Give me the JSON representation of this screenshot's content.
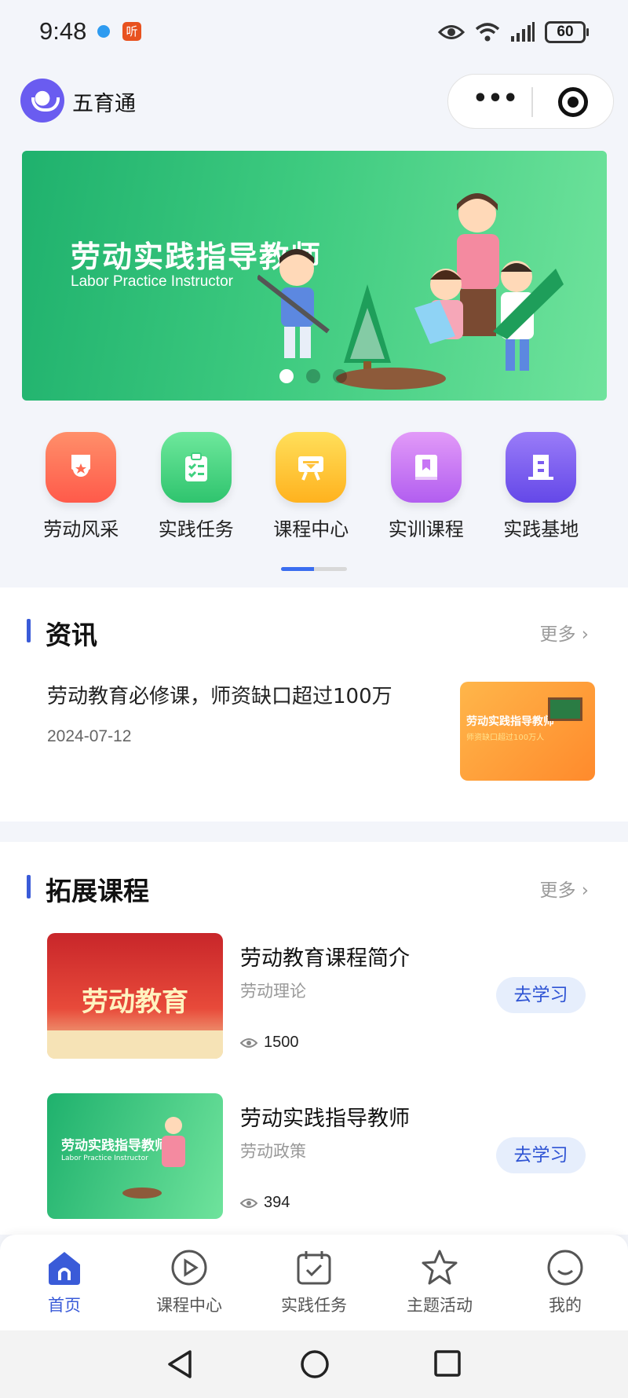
{
  "status_bar": {
    "time": "9:48",
    "notif_badge": "听",
    "battery": "60"
  },
  "app": {
    "name": "五育通"
  },
  "banner": {
    "title": "劳动实践指导教师",
    "subtitle": "Labor Practice Instructor",
    "active_index": 0,
    "dot_count": 3
  },
  "quick_nav": [
    {
      "label": "劳动风采",
      "icon": "medal-icon",
      "color": "#ff6b52"
    },
    {
      "label": "实践任务",
      "icon": "clipboard-check-icon",
      "color": "#3fd07f"
    },
    {
      "label": "课程中心",
      "icon": "course-board-icon",
      "color": "#ffc23b"
    },
    {
      "label": "实训课程",
      "icon": "bookmark-book-icon",
      "color": "#c775f5"
    },
    {
      "label": "实践基地",
      "icon": "building-icon",
      "color": "#7b5cf0"
    }
  ],
  "news": {
    "section_title": "资讯",
    "more": "更多 ›",
    "item": {
      "title": "劳动教育必修课，师资缺口超过100万",
      "date": "2024-07-12",
      "thumb_text": "劳动实践指导教师",
      "thumb_sub": "师资缺口超过100万人"
    }
  },
  "courses": {
    "section_title": "拓展课程",
    "more": "更多 ›",
    "items": [
      {
        "title": "劳动教育课程简介",
        "tag": "劳动理论",
        "views": "1500",
        "button": "去学习",
        "thumb_text": "劳动教育"
      },
      {
        "title": "劳动实践指导教师",
        "tag": "劳动政策",
        "views": "394",
        "button": "去学习",
        "thumb_text": "劳动实践指导教师",
        "thumb_sub": "Labor Practice Instructor"
      }
    ]
  },
  "tabbar": [
    {
      "label": "首页",
      "icon": "home-icon",
      "active": true
    },
    {
      "label": "课程中心",
      "icon": "play-circle-icon",
      "active": false
    },
    {
      "label": "实践任务",
      "icon": "calendar-check-icon",
      "active": false
    },
    {
      "label": "主题活动",
      "icon": "star-icon",
      "active": false
    },
    {
      "label": "我的",
      "icon": "smile-icon",
      "active": false
    }
  ],
  "colors": {
    "accent": "#3a5bd8",
    "button_bg": "#e6eefc",
    "banner_green": "#2fbf74"
  }
}
